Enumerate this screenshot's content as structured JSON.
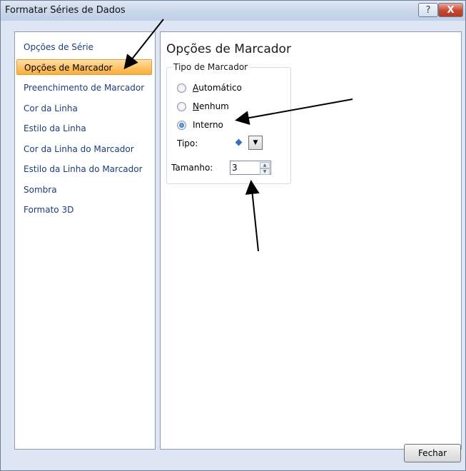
{
  "window": {
    "title": "Formatar Séries de Dados",
    "help_glyph": "?",
    "close_glyph": "X"
  },
  "sidebar": {
    "items": [
      {
        "label": "Opções de Série",
        "active": false
      },
      {
        "label": "Opções de Marcador",
        "active": true
      },
      {
        "label": "Preenchimento de Marcador",
        "active": false
      },
      {
        "label": "Cor da Linha",
        "active": false
      },
      {
        "label": "Estilo da Linha",
        "active": false
      },
      {
        "label": "Cor da Linha do Marcador",
        "active": false
      },
      {
        "label": "Estilo da Linha do Marcador",
        "active": false
      },
      {
        "label": "Sombra",
        "active": false
      },
      {
        "label": "Formato 3D",
        "active": false
      }
    ]
  },
  "panel": {
    "title": "Opções de Marcador",
    "group_label": "Tipo de Marcador",
    "radios": [
      {
        "label": "Automático",
        "accesskey": "A",
        "checked": false
      },
      {
        "label": "Nenhum",
        "accesskey": "N",
        "checked": false
      },
      {
        "label": "Interno",
        "accesskey": "",
        "checked": true
      }
    ],
    "type_label": "Tipo:",
    "type_icon": "diamond-marker-icon",
    "size_label": "Tamanho:",
    "size_value": "3"
  },
  "footer": {
    "close_label": "Fechar"
  },
  "colors": {
    "active_item": "#ffc46a",
    "link_text": "#1b3e7a",
    "marker": "#3d6fb5"
  }
}
